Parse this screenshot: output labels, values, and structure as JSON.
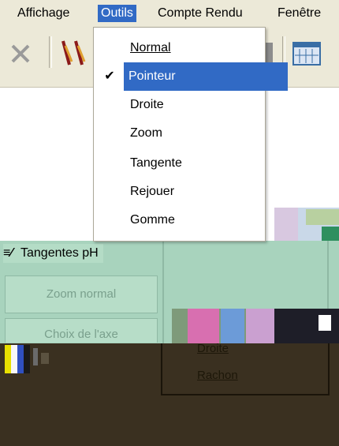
{
  "menubar": {
    "items": [
      {
        "label": "Affichage"
      },
      {
        "label": "Outils"
      },
      {
        "label": "Compte Rendu"
      },
      {
        "label": "Fenêtre"
      }
    ]
  },
  "dropdown": {
    "items": [
      {
        "label": "Normal",
        "checked": false
      },
      {
        "label": "Pointeur",
        "checked": true,
        "highlighted": true
      },
      {
        "label": "Droite",
        "checked": false
      },
      {
        "label": "Zoom",
        "checked": false
      },
      {
        "label": "Tangente",
        "checked": false
      },
      {
        "label": "Rejouer",
        "checked": false
      },
      {
        "label": "Gomme",
        "checked": false
      }
    ],
    "check_glyph": "✔"
  },
  "side_panel": {
    "label": "Tangentes pH",
    "buttons": [
      {
        "label": "Zoom normal"
      },
      {
        "label": "Choix de l'axe"
      }
    ]
  },
  "context_menu": {
    "items": [
      {
        "label": "Droite"
      },
      {
        "label": "Rachon"
      }
    ]
  },
  "colors": {
    "menu_highlight": "#316ac5",
    "menubar_bg": "#ece9d8",
    "panel_green": "#a8d3bd",
    "panel_dark": "#3a3020"
  }
}
